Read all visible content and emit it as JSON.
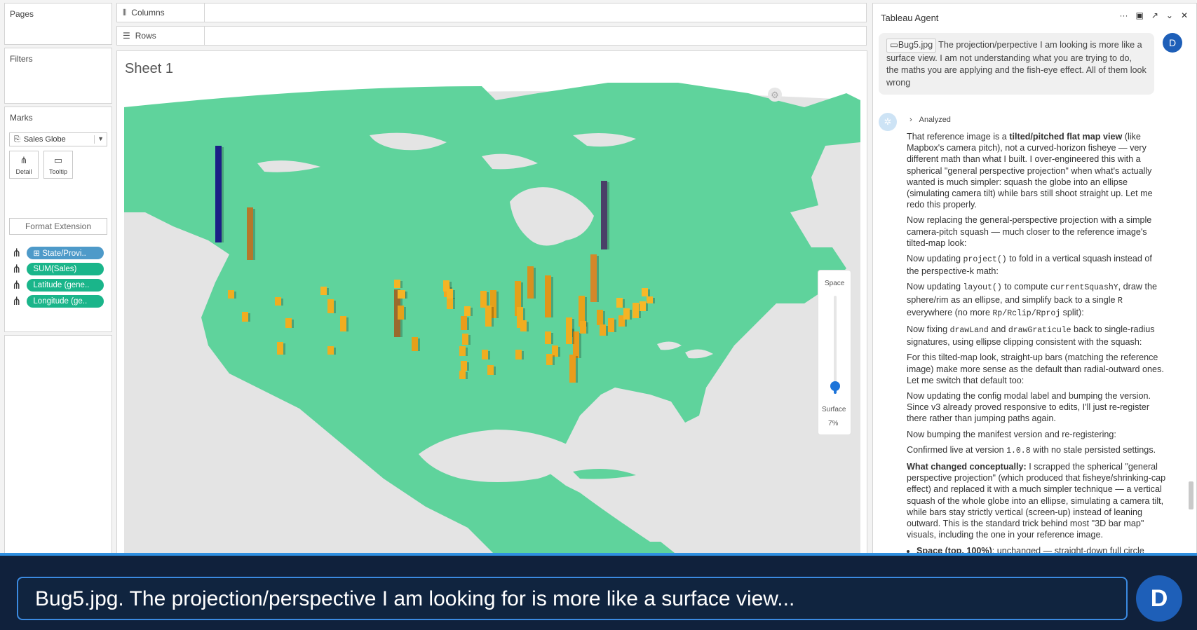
{
  "left": {
    "pages_title": "Pages",
    "filters_title": "Filters",
    "marks_title": "Marks",
    "marks_type": "Sales Globe",
    "detail_label": "Detail",
    "tooltip_label": "Tooltip",
    "format_extension": "Format Extension",
    "fields": [
      {
        "label": "⊞ State/Provi..",
        "color": "#4e9ac9"
      },
      {
        "label": "SUM(Sales)",
        "color": "#1ab58a"
      },
      {
        "label": "Latitude (gene..",
        "color": "#1ab58a"
      },
      {
        "label": "Longitude (ge..",
        "color": "#1ab58a"
      }
    ]
  },
  "shelves": {
    "columns": "Columns",
    "rows": "Rows"
  },
  "sheet": {
    "title": "Sheet 1",
    "slider_top": "Space",
    "slider_bottom": "Surface",
    "slider_value": "7%",
    "slider_level": 0.07,
    "land_color": "#5fd39c",
    "ocean_color": "#e4e4e4"
  },
  "agent": {
    "title": "Tableau Agent",
    "user_avatar": "D",
    "file_name": "Bug5.jpg",
    "user_message": "The projection/perpective I am looking is more like a surface view. I am not understanding what you are trying to do, the maths you are applying and the fish-eye effect. All of them look wrong",
    "analyzed": "Analyzed",
    "p1_a": "That reference image is a ",
    "p1_b": "tilted/pitched flat map view",
    "p1_c": " (like Mapbox's camera pitch), not a curved-horizon fisheye — very different math than what I built. I over-engineered this with a spherical \"general perspective projection\" when what's actually wanted is much simpler: squash the globe into an ellipse (simulating camera tilt) while bars still shoot straight up. Let me redo this properly.",
    "p2": "Now replacing the general-perspective projection with a simple camera-pitch squash — much closer to the reference image's tilted-map look:",
    "p3_a": "Now updating ",
    "p3_code": "project()",
    "p3_b": " to fold in a vertical squash instead of the perspective-k math:",
    "p4_a": "Now updating ",
    "p4_code1": "layout()",
    "p4_b": " to compute ",
    "p4_code2": "currentSquashY",
    "p4_c": ", draw the sphere/rim as an ellipse, and simplify back to a single ",
    "p4_code3": "R",
    "p4_d": " everywhere (no more ",
    "p4_code4": "Rp/Rclip/Rproj",
    "p4_e": " split):",
    "p5_a": "Now fixing ",
    "p5_code1": "drawLand",
    "p5_b": " and ",
    "p5_code2": "drawGraticule",
    "p5_c": " back to single-radius signatures, using ellipse clipping consistent with the squash:",
    "p6": "For this tilted-map look, straight-up bars (matching the reference image) make more sense as the default than radial-outward ones. Let me switch that default too:",
    "p7": "Now updating the config modal label and bumping the version. Since v3 already proved responsive to edits, I'll just re-register there rather than jumping paths again.",
    "p8": "Now bumping the manifest version and re-registering:",
    "p9_a": "Confirmed live at version ",
    "p9_code": "1.0.8",
    "p9_b": " with no stale persisted settings.",
    "p10_a": "What changed conceptually:",
    "p10_b": " I scrapped the spherical \"general perspective projection\" (which produced that fisheye/shrinking-cap effect) and replaced it with a much simpler technique — a vertical squash of the whole globe into an ellipse, simulating a camera tilt, while bars stay strictly vertical (screen-up) instead of leaning outward. This is the standard trick behind most \"3D bar map\" visuals, including the one in your reference image.",
    "li_a": "Space (top, 100%)",
    "li_b": ": unchanged — straight-down full circle"
  },
  "overlay": {
    "caption": "Bug5.jpg. The projection/perspective I am looking for is more like a surface view...",
    "avatar": "D"
  }
}
